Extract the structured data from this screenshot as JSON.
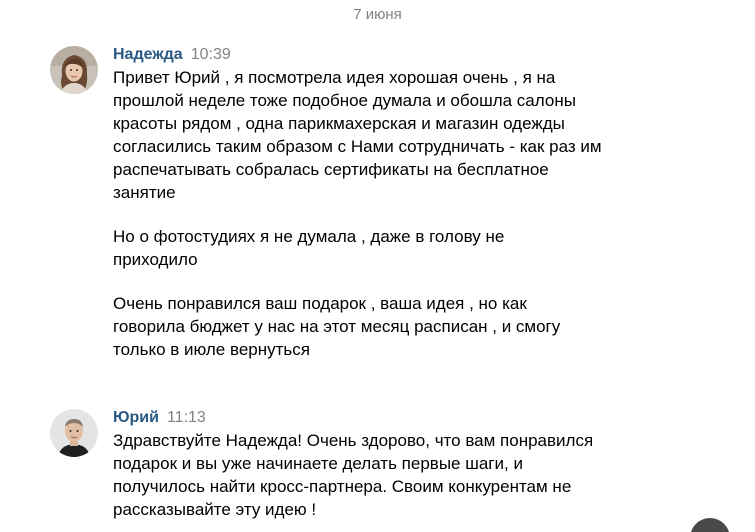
{
  "chat": {
    "date_divider": "7 июня",
    "messages": [
      {
        "author": "Надежда",
        "time": "10:39",
        "avatar": "woman-avatar",
        "paragraphs": [
          [
            "Привет Юрий , я посмотрела идея хорошая очень , я на",
            "прошлой неделе тоже подобное думала и обошла салоны",
            "красоты рядом , одна парикмахерская и магазин одежды",
            "согласились таким образом с Нами сотрудничать - как раз им",
            "распечатывать собралась сертификаты на бесплатное",
            "занятие"
          ],
          [
            "Но о фотостудиях я не думала , даже в голову не",
            "приходило"
          ],
          [
            "Очень понравился ваш подарок , ваша идея , но как",
            "говорила бюджет у нас на этот месяц расписан , и смогу",
            "только в июле вернуться"
          ]
        ]
      },
      {
        "author": "Юрий",
        "time": "11:13",
        "avatar": "man-avatar",
        "paragraphs": [
          [
            "Здравствуйте Надежда! Очень здорово, что вам понравился",
            "подарок и вы уже начинаете делать первые шаги, и",
            "получилось найти кросс-партнера. Своим конкурентам не",
            "рассказывайте эту идею !"
          ]
        ]
      }
    ]
  },
  "colors": {
    "author": "#2a5885",
    "meta": "#828282",
    "text": "#000000"
  }
}
